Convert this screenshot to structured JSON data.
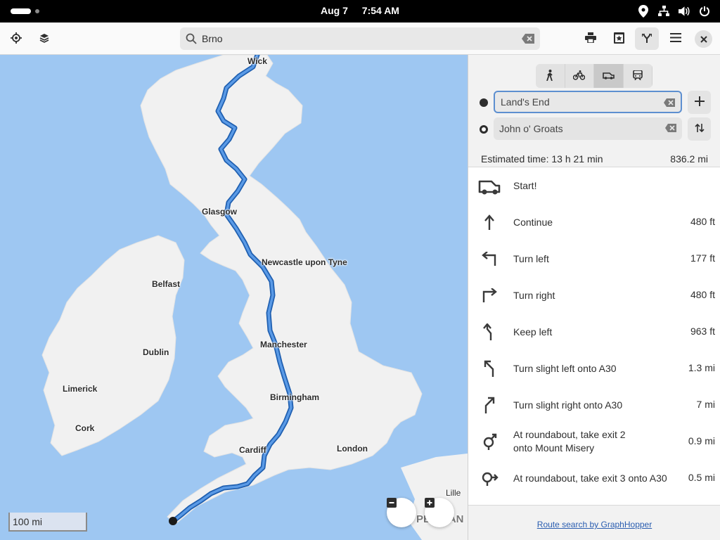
{
  "system_bar": {
    "date": "Aug 7",
    "time": "7:54 AM",
    "icons": [
      "location-icon",
      "network-icon",
      "volume-icon",
      "power-icon"
    ]
  },
  "header": {
    "locate_icon": "locate-icon",
    "layers_icon": "layers-icon",
    "search": {
      "value": "Brno",
      "placeholder": "Search"
    },
    "actions": [
      "print-icon",
      "favorites-icon",
      "route-icon",
      "menu-icon",
      "close-icon"
    ]
  },
  "map": {
    "labels": {
      "wick": "Wick",
      "glasgow": "Glasgow",
      "newcastle": "Newcastle upon Tyne",
      "belfast": "Belfast",
      "dublin": "Dublin",
      "manchester": "Manchester",
      "limerick": "Limerick",
      "birmingham": "Birmingham",
      "cork": "Cork",
      "cardiff": "Cardiff",
      "london": "London",
      "lille": "Lille",
      "peninsula": "PENIRAN"
    },
    "scale": "100 mi",
    "colors": {
      "water": "#9ec7f2",
      "land": "#f2f2f2",
      "route": "#3a7bd5"
    }
  },
  "sidebar": {
    "modes": [
      {
        "name": "walk",
        "icon": "pedestrian-icon",
        "selected": false
      },
      {
        "name": "bike",
        "icon": "bicycle-icon",
        "selected": false
      },
      {
        "name": "car",
        "icon": "car-icon",
        "selected": true
      },
      {
        "name": "transit",
        "icon": "transit-icon",
        "selected": false
      }
    ],
    "from": {
      "value": "Land's End"
    },
    "to": {
      "value": "John o' Groats"
    },
    "estimated_time": "Estimated time: 13 h 21 min",
    "total_distance": "836.2 mi",
    "steps": [
      {
        "icon": "car-start-icon",
        "text": "Start!",
        "distance": ""
      },
      {
        "icon": "arrow-up-icon",
        "text": "Continue",
        "distance": "480 ft"
      },
      {
        "icon": "turn-left-icon",
        "text": "Turn left",
        "distance": "177 ft"
      },
      {
        "icon": "turn-right-icon",
        "text": "Turn right",
        "distance": "480 ft"
      },
      {
        "icon": "keep-left-icon",
        "text": "Keep left",
        "distance": "963 ft"
      },
      {
        "icon": "slight-left-icon",
        "text": "Turn slight left onto A30",
        "distance": "1.3 mi"
      },
      {
        "icon": "slight-right-icon",
        "text": "Turn slight right onto A30",
        "distance": "7 mi"
      },
      {
        "icon": "roundabout-icon",
        "text": "At roundabout, take exit 2",
        "text2": "onto Mount Misery",
        "distance": "0.9 mi"
      },
      {
        "icon": "roundabout-icon",
        "text": "At roundabout, take exit 3 onto A30",
        "distance": "0.5 mi"
      }
    ],
    "credit": "Route search by GraphHopper"
  }
}
